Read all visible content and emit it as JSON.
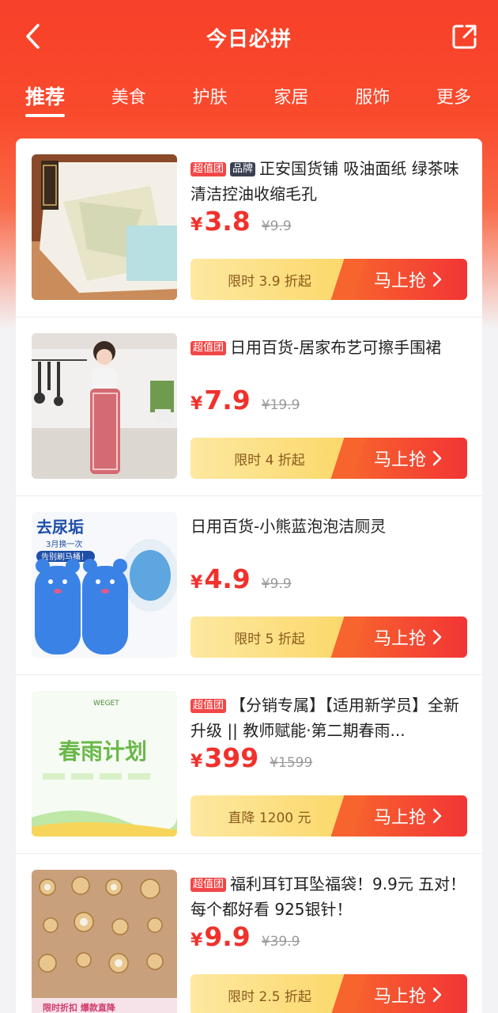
{
  "header": {
    "title": "今日必拼",
    "back_icon": "chevron-left-icon",
    "share_icon": "share-out-icon"
  },
  "tabs": [
    {
      "label": "推荐",
      "active": true
    },
    {
      "label": "美食",
      "active": false
    },
    {
      "label": "护肤",
      "active": false
    },
    {
      "label": "家居",
      "active": false
    },
    {
      "label": "服饰",
      "active": false
    },
    {
      "label": "更多",
      "active": false
    }
  ],
  "products": [
    {
      "tags": [
        "超值团",
        "品牌"
      ],
      "title": "正安国货铺 吸油面纸 绿茶味 清洁控油收缩毛孔",
      "currency": "¥",
      "price": "3.8",
      "original_price": "¥9.9",
      "discount": "限时 3.9 折起",
      "buy_label": "马上抢"
    },
    {
      "tags": [
        "超值团"
      ],
      "title": "日用百货-居家布艺可擦手围裙",
      "currency": "¥",
      "price": "7.9",
      "original_price": "¥19.9",
      "discount": "限时 4 折起",
      "buy_label": "马上抢"
    },
    {
      "tags": [],
      "title": "日用百货-小熊蓝泡泡洁厕灵",
      "thumb_text": {
        "headline": "去尿垢",
        "sub": "3月换一次",
        "banner": "告别刷马桶！"
      },
      "currency": "¥",
      "price": "4.9",
      "original_price": "¥9.9",
      "discount": "限时 5 折起",
      "buy_label": "马上抢"
    },
    {
      "tags": [
        "超值团"
      ],
      "title": "【分销专属】【适用新学员】全新升级 || 教师赋能·第二期春雨...",
      "thumb_text": {
        "brand": "WEGET",
        "headline": "春雨计划"
      },
      "currency": "¥",
      "price": "399",
      "original_price": "¥1599",
      "discount": "直降 1200 元",
      "buy_label": "马上抢"
    },
    {
      "tags": [
        "超值团"
      ],
      "title": "福利耳钉耳坠福袋！9.9元 五对！ 每个都好看 925银针！",
      "thumb_text": {
        "banner": "限时折扣 爆款直降"
      },
      "currency": "¥",
      "price": "9.9",
      "original_price": "¥39.9",
      "discount": "限时 2.5 折起",
      "buy_label": "马上抢"
    }
  ],
  "colors": {
    "brand_red": "#f8402a",
    "price_red": "#f0312c",
    "discount_bg": "#fbd86a",
    "buy_bg": "#f23535"
  }
}
